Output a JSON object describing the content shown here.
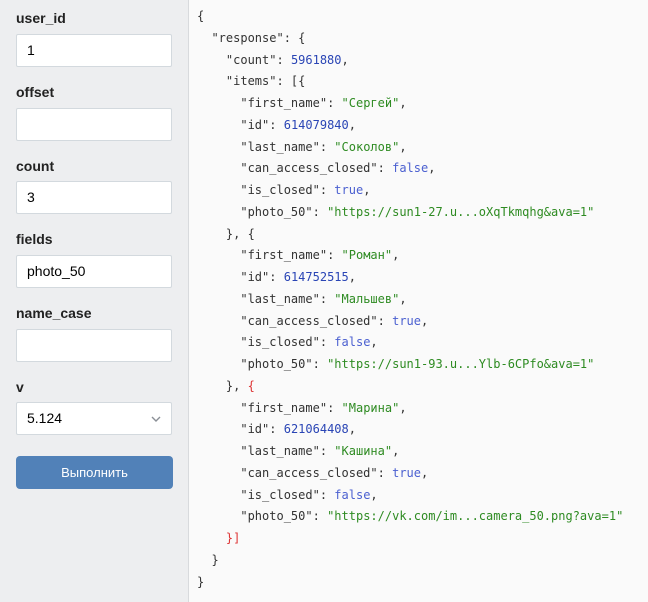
{
  "form": {
    "fields": [
      {
        "label": "user_id",
        "value": "1"
      },
      {
        "label": "offset",
        "value": ""
      },
      {
        "label": "count",
        "value": "3"
      },
      {
        "label": "fields",
        "value": "photo_50"
      },
      {
        "label": "name_case",
        "value": ""
      }
    ],
    "version": {
      "label": "v",
      "value": "5.124"
    },
    "submit_label": "Выполнить"
  },
  "response": {
    "count": "5961880",
    "items": [
      {
        "first_name": "Сергей",
        "id": "614079840",
        "last_name": "Соколов",
        "can_access_closed": "false",
        "is_closed": "true",
        "photo_50": "https://sun1-27.u...oXqTkmqhg&ava=1"
      },
      {
        "first_name": "Роман",
        "id": "614752515",
        "last_name": "Мальшев",
        "can_access_closed": "true",
        "is_closed": "false",
        "photo_50": "https://sun1-93.u...Ylb-6CPfo&ava=1"
      },
      {
        "first_name": "Марина",
        "id": "621064408",
        "last_name": "Кашина",
        "can_access_closed": "true",
        "is_closed": "false",
        "photo_50": "https://vk.com/im...camera_50.png?ava=1"
      }
    ]
  },
  "colors": {
    "button": "#5181b8",
    "string": "#2e8b22",
    "number": "#2a45b5",
    "boolean": "#4a5fd0"
  }
}
